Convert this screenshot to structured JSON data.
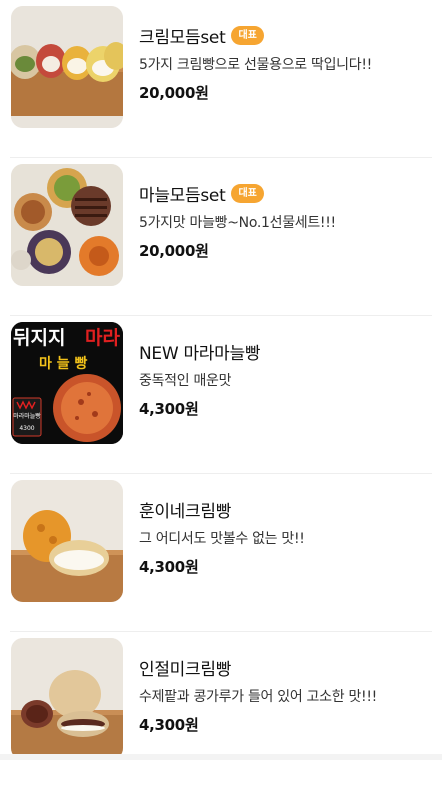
{
  "menu": {
    "items": [
      {
        "name": "크림모듬set",
        "badge": "대표",
        "desc": "5가지 크림빵으로 선물용으로 딱입니다!!",
        "price": "20,000원",
        "image_icon": "cream-bread-set-photo"
      },
      {
        "name": "마늘모듬set",
        "badge": "대표",
        "desc": "5가지맛 마늘빵~No.1선물세트!!!",
        "price": "20,000원",
        "image_icon": "garlic-bread-set-photo"
      },
      {
        "name": "NEW 마라마늘빵",
        "desc": "중독적인 매운맛",
        "price": "4,300원",
        "image_icon": "mala-garlic-bread-poster",
        "image_text": {
          "line1": "뒤지지",
          "line1_red": "마라",
          "line2": "마 늘 빵",
          "tag": "마라마늘빵",
          "tag_price": "4300"
        }
      },
      {
        "name": "훈이네크림빵",
        "desc": "그 어디서도 맛볼수 없는 맛!!",
        "price": "4,300원",
        "image_icon": "cream-bread-photo"
      },
      {
        "name": "인절미크림빵",
        "desc": "수제팥과 콩가루가 들어 있어 고소한 맛!!!",
        "price": "4,300원",
        "image_icon": "injeolmi-cream-bread-photo"
      }
    ]
  },
  "colors": {
    "badge": "#f6a531",
    "divider": "#eeeeee",
    "poster_red": "#e02020"
  }
}
